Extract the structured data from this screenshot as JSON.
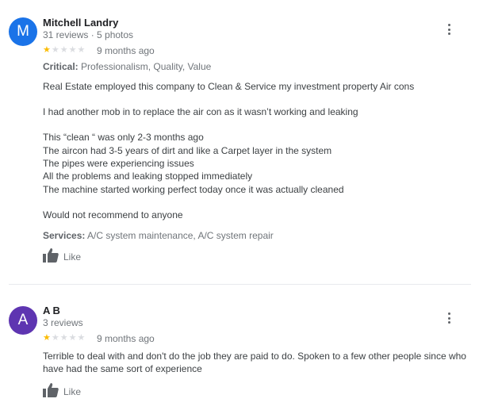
{
  "reviews": [
    {
      "avatar_letter": "M",
      "avatar_color": "#1a73e8",
      "name": "Mitchell Landry",
      "meta": "31 reviews · 5 photos",
      "rating": 1,
      "time": "9 months ago",
      "critical_label": "Critical:",
      "critical_value": "Professionalism, Quality, Value",
      "body_lines": [
        "Real Estate employed this company to Clean & Service my investment property Air cons",
        "",
        "I had another mob in to replace the air con as it wasn’t working and leaking",
        "",
        "This “clean “ was only 2-3 months ago",
        "The aircon had 3-5 years of dirt and like a Carpet layer in the system",
        "The pipes were experiencing issues",
        "All the problems and leaking stopped immediately",
        "The machine started working perfect today once it was actually cleaned",
        "",
        "Would not recommend to anyone"
      ],
      "services_label": "Services:",
      "services_value": "A/C system maintenance, A/C system repair",
      "like_label": "Like"
    },
    {
      "avatar_letter": "A",
      "avatar_color": "#5e35b1",
      "name": "A B",
      "meta": "3 reviews",
      "rating": 1,
      "time": "9 months ago",
      "body_lines": [
        "Terrible to deal with and don't do the job they are paid to do. Spoken to a few other people since who",
        "have had the same sort of experience"
      ],
      "like_label": "Like"
    }
  ]
}
